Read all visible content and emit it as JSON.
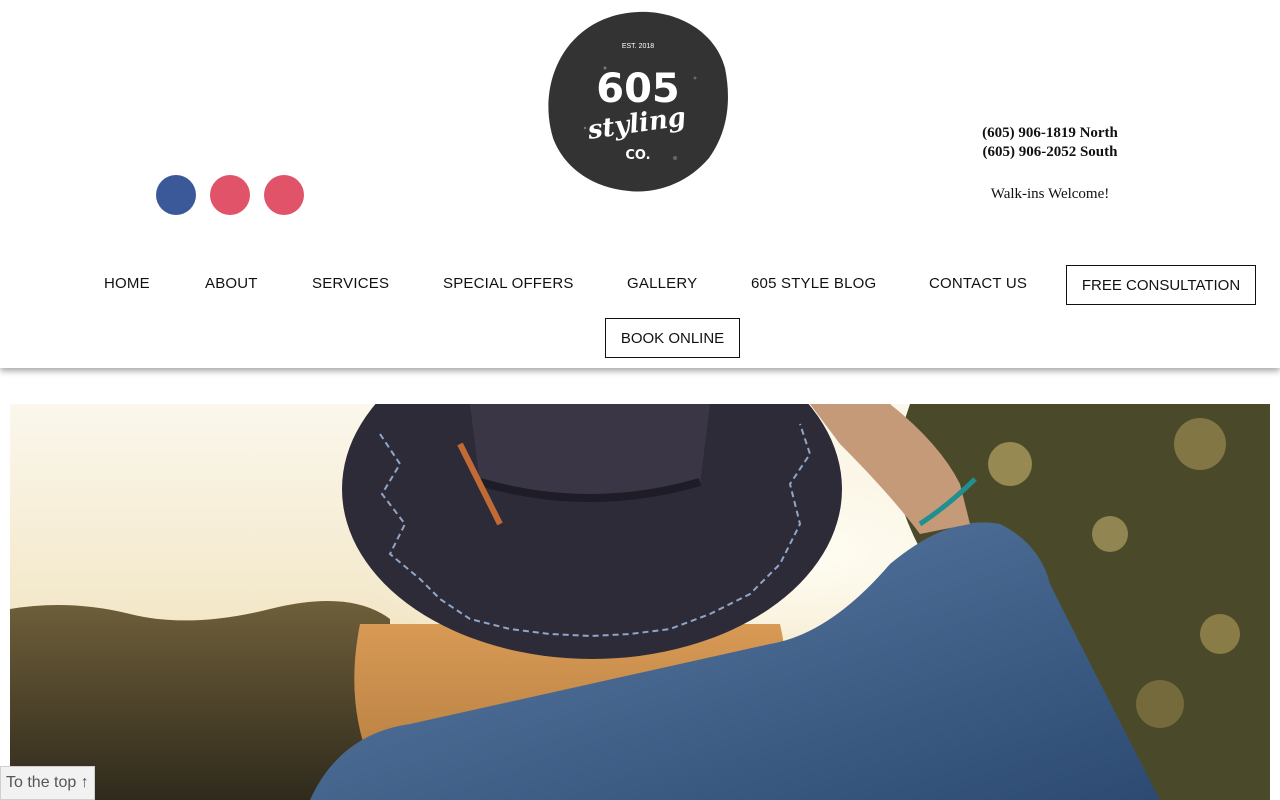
{
  "logo": {
    "est": "EST. 2018",
    "number": "605",
    "word": "styling",
    "suffix": "CO."
  },
  "social": [
    {
      "icon": "facebook-icon",
      "glyph": "",
      "color": "#3b5998"
    },
    {
      "icon": "instagram-icon",
      "glyph": "",
      "color": "#e05368"
    },
    {
      "icon": "yelp-icon",
      "glyph": "",
      "color": "#e05368"
    }
  ],
  "contact": {
    "phone_north": "(605) 906-1819 North",
    "phone_south": "(605) 906-2052 South",
    "walkins": "Walk-ins Welcome!"
  },
  "nav": {
    "items": [
      "HOME",
      "ABOUT",
      "SERVICES",
      "SPECIAL OFFERS",
      "GALLERY",
      "605 STYLE BLOG",
      "CONTACT US"
    ],
    "free_consultation": "FREE CONSULTATION",
    "book_online": "BOOK ONLINE"
  },
  "to_top": "To the top ↑",
  "colors": {
    "facebook": "#3b5998",
    "social_pink": "#e05368",
    "logo_dark": "#333333"
  }
}
